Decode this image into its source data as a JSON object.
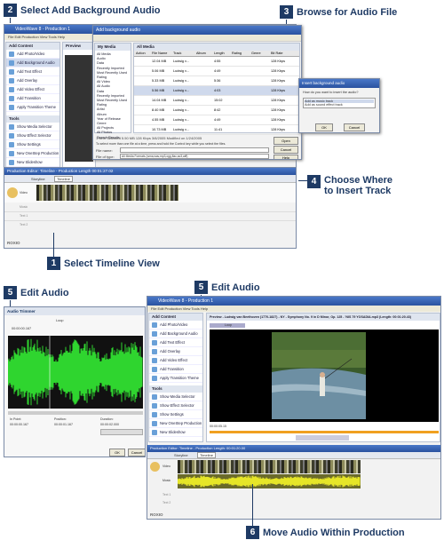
{
  "callouts": {
    "c2": {
      "num": "2",
      "text": "Select Add Background Audio"
    },
    "c3": {
      "num": "3",
      "text": "Browse for Audio File"
    },
    "c4": {
      "num": "4",
      "text": "Choose Where\nto Insert Track"
    },
    "c1": {
      "num": "1",
      "text": "Select Timeline View"
    },
    "c5a": {
      "num": "5",
      "text": "Edit Audio"
    },
    "c5b": {
      "num": "5",
      "text": "Edit Audio"
    },
    "c6": {
      "num": "6",
      "text": "Move Audio Within Production"
    }
  },
  "main_window": {
    "title": "VideoWave 8 - Production 1",
    "menu": "File  Edit  Production  View  Tools  Help",
    "add_content": "Add Content",
    "add_items": [
      "Add Photo/Video",
      "Add Background Audio",
      "Add Text Effect",
      "Add Overlay",
      "Add Video Effect",
      "Add Transition",
      "Apply Transition Theme"
    ],
    "tools": "Tools",
    "tool_items": [
      "Show Media Selector",
      "Show Effect Selector",
      "Show Settings",
      "New OneStep Production",
      "New Slideshow",
      "CaptureDirect"
    ],
    "preview_label": "Preview",
    "timecode": "00:00:07.18"
  },
  "dialog": {
    "title": "Add background audio",
    "my_media": "My Media",
    "all_media": "All Media",
    "tree": [
      "All Media",
      "Audio",
      "Data",
      "Recently Imported",
      "Most Recently Used",
      "Rating",
      "All Video",
      "All Audio",
      "Data",
      "Recently Imported",
      "Most Recently Used",
      "Rating",
      "Artist",
      "Album",
      "Year of Release",
      "Genre",
      "All Projects",
      "All Photos",
      "Search Results"
    ],
    "columns": [
      "Action",
      "File Name",
      "Track",
      "Album",
      "Length",
      "Rating",
      "Genre",
      "Bit Rate"
    ],
    "rows": [
      [
        "",
        "12.04 MB",
        "Ludwig v...",
        "",
        "4:55",
        "",
        "",
        "128 Kbps"
      ],
      [
        "",
        "5.06 MB",
        "Ludwig v...",
        "",
        "4:49",
        "",
        "",
        "128 Kbps"
      ],
      [
        "",
        "5.33 MB",
        "Ludwig v...",
        "",
        "5:36",
        "",
        "",
        "128 Kbps"
      ],
      [
        "",
        "5.56 MB",
        "Ludwig v...",
        "",
        "4:03",
        "",
        "",
        "128 Kbps"
      ],
      [
        "",
        "14.04 MB",
        "Ludwig v...",
        "",
        "15:02",
        "",
        "",
        "128 Kbps"
      ],
      [
        "",
        "8.40 MB",
        "Ludwig v...",
        "",
        "8:42",
        "",
        "",
        "128 Kbps"
      ],
      [
        "",
        "4.55 MB",
        "Ludwig v...",
        "",
        "4:49",
        "",
        "",
        "128 Kbps"
      ],
      [
        "",
        "10.73 MB",
        "Ludwig v...",
        "",
        "11:41",
        "",
        "",
        "128 Kbps"
      ]
    ],
    "status": "1 Item Selected     5.50 MB  128 Kbps  3/8/2005  Modified on 1/24/2005",
    "hint": "To select more than one file at a time, press and hold the Control key while you select the files.",
    "file_name_label": "File name:",
    "type_label": "File of type:",
    "type_value": "All Media Formats (wma,wav,mp3,ogg,flac,ac3,aiff)",
    "open": "Open",
    "cancel": "Cancel",
    "help": "Help"
  },
  "insert_dialog": {
    "title": "Insert background audio",
    "question": "How do you want to insert the audio?",
    "option1": "Add as music track",
    "option2": "Add as sound effect track",
    "ok": "OK",
    "cancel": "Cancel"
  },
  "timeline": {
    "title": "Production Editor: Timeline - Production Length 00:01:27.02",
    "storyline": "Storyline",
    "timeline": "Timeline",
    "tracks": [
      "Video",
      "Music",
      "Text 1",
      "Text 2"
    ],
    "roxio": "ROXIO"
  },
  "audio_trimmer": {
    "title": "Audio Trimmer",
    "loop": "Loop",
    "timecode": "00:00:00.167",
    "in_label": "In Point:",
    "pos_label": "Position:",
    "dur_label": "Duration:",
    "in_value": "00:00:00.167",
    "pos_value": "00:00:01.167",
    "dur_value": "00:00:02.000",
    "ok": "OK",
    "cancel": "Cancel"
  },
  "main_window2": {
    "title": "VideoWave 8 - Production 1",
    "preview_title": "Preview - Ludwig van Beethoven (1770-1827) - NY - Symphony No. 9 in D Minor, Op. 125 - 'NIS 79 YOSADIA.mp3 (Length: 00:01:20.43)",
    "loop": "Loop",
    "timecode": "00:00:05.15",
    "timeline_title": "Production Editor: Timeline - Production Length: 00:01:20.00",
    "tracks": [
      "Video",
      "Music",
      "Text 1",
      "Text 2"
    ]
  },
  "colors": {
    "accent": "#1e3a64",
    "title_bar": "#2a52a0",
    "audio_wave": "#2fd52f",
    "audio_track": "#e6e628"
  }
}
